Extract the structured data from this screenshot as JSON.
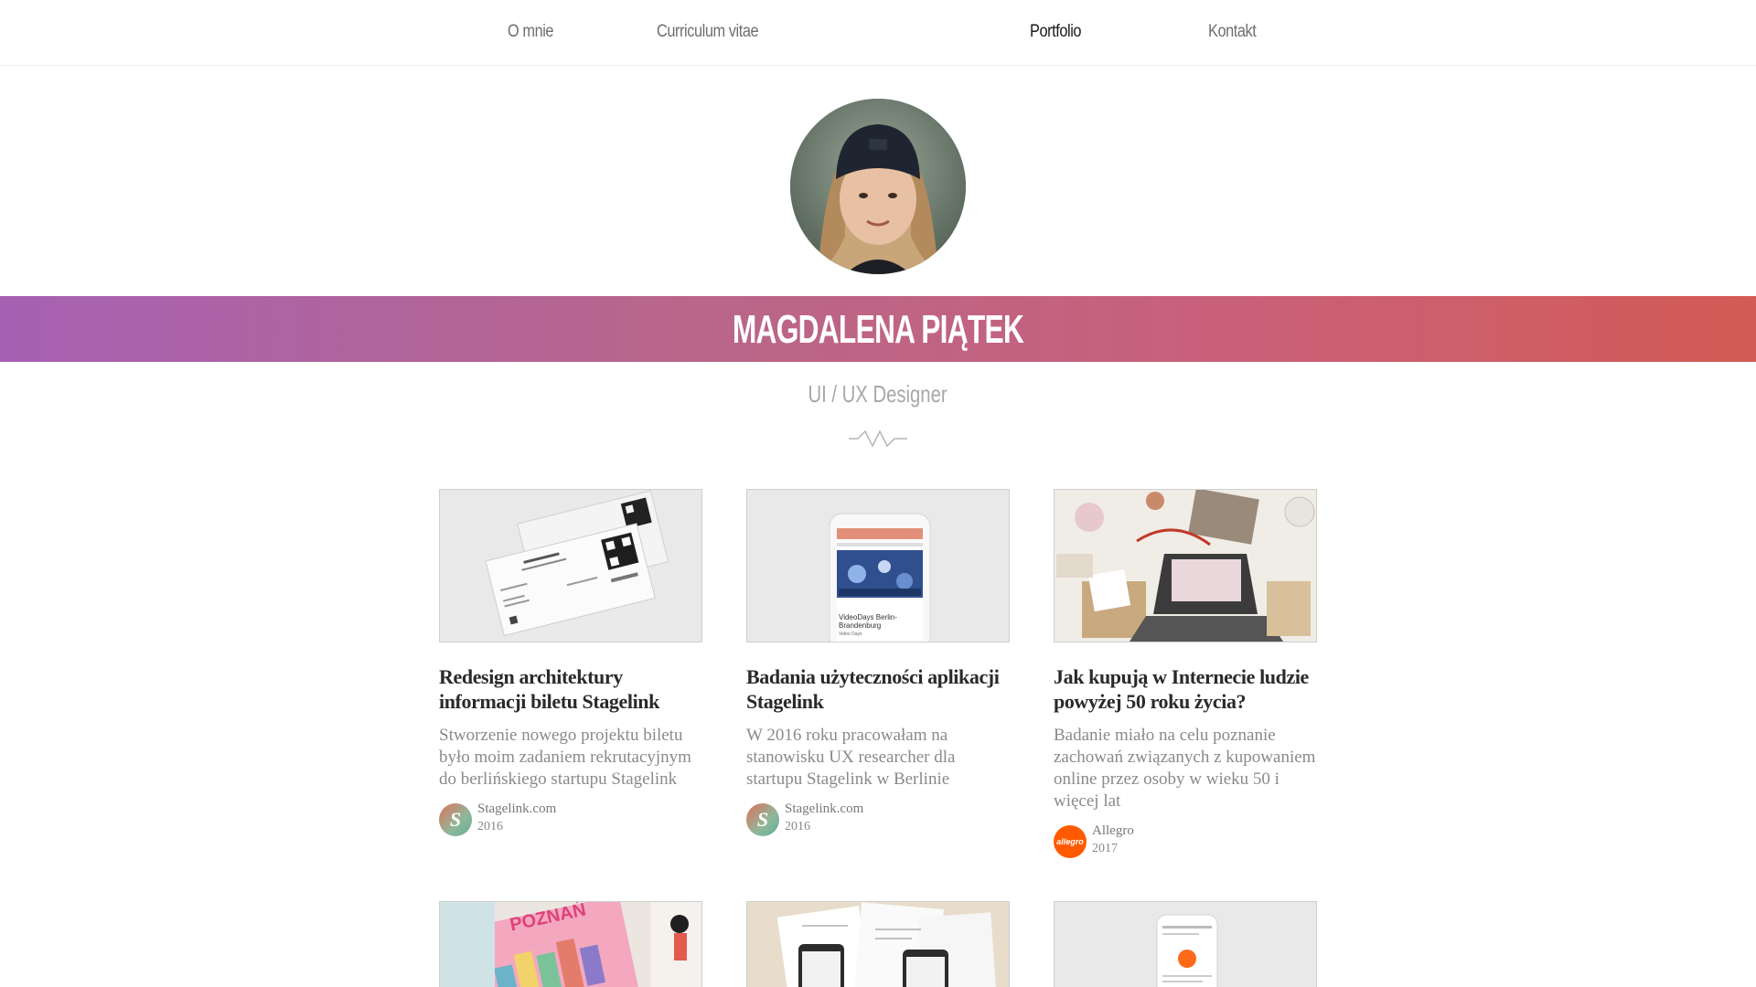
{
  "nav": {
    "items": [
      {
        "label": "O mnie"
      },
      {
        "label": "Curriculum vitae"
      },
      {
        "label": "Portfolio",
        "active": true
      },
      {
        "label": "Kontakt"
      }
    ]
  },
  "hero": {
    "name": "MAGDALENA PIĄTEK",
    "role": "UI / UX Designer"
  },
  "colors": {
    "gradient_start": "#a661b3",
    "gradient_end": "#d35b55",
    "allegro_orange": "#ff5a00"
  },
  "projects": [
    {
      "title": "Redesign architektury informacji biletu Stagelink",
      "description": "Stworzenie nowego projektu biletu było moim zadaniem rekrutacyjnym do berlińskiego startupu Stagelink",
      "client": "Stagelink.com",
      "year": "2016",
      "logo": "stagelink-logo"
    },
    {
      "title": "Badania użyteczności aplikacji Stagelink",
      "description": "W 2016 roku pracowałam na stanowisku UX researcher dla startupu Stagelink w Berlinie",
      "client": "Stagelink.com",
      "year": "2016",
      "logo": "stagelink-logo",
      "phone_text_1": "VideoDays Berlin-Brandenburg",
      "phone_text_2": "Video Days"
    },
    {
      "title": "Jak kupują w Internecie ludzie powyżej 50 roku życia?",
      "description": "Badanie miało na celu poznanie zachowań związanych z kupowaniem online przez osoby w wieku 50 i więcej lat",
      "client": "Allegro",
      "year": "2017",
      "logo": "allegro-logo",
      "logo_text": "allegro"
    }
  ],
  "preview_texts": {
    "poznan": "POZNAŃ"
  }
}
